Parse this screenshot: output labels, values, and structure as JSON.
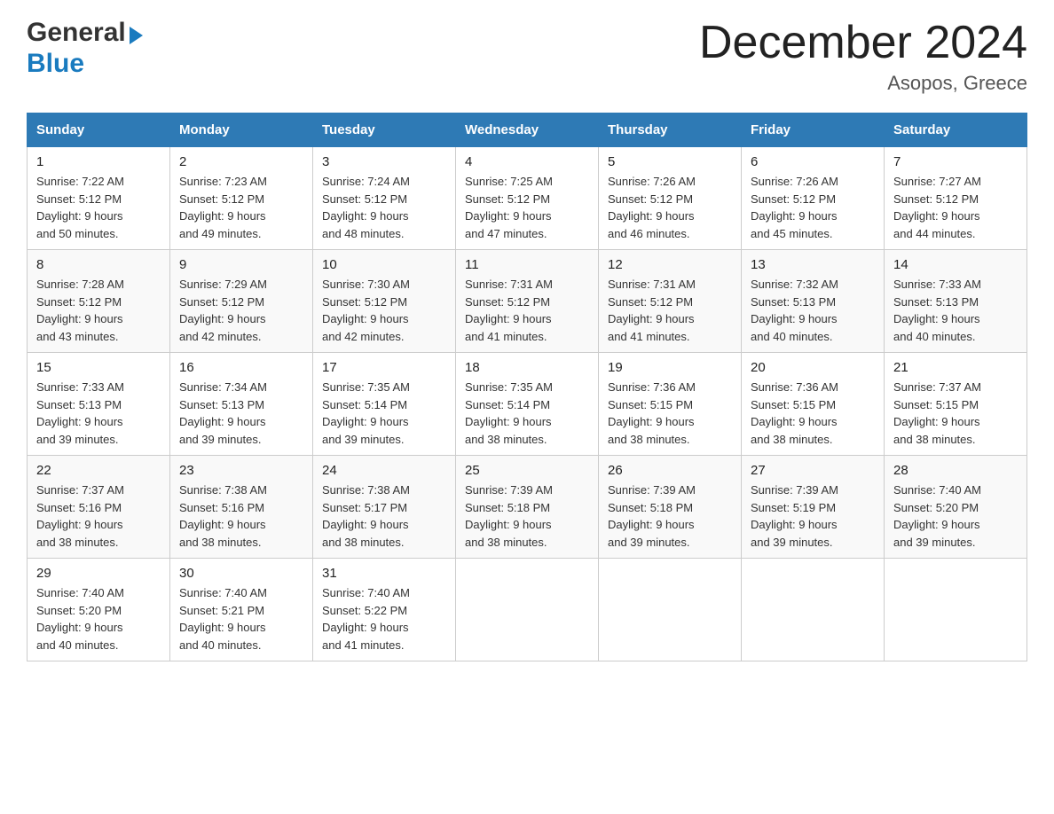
{
  "logo": {
    "general": "General",
    "blue": "Blue",
    "arrow": "▶"
  },
  "title": "December 2024",
  "subtitle": "Asopos, Greece",
  "days_of_week": [
    "Sunday",
    "Monday",
    "Tuesday",
    "Wednesday",
    "Thursday",
    "Friday",
    "Saturday"
  ],
  "weeks": [
    [
      {
        "day": "1",
        "sunrise": "7:22 AM",
        "sunset": "5:12 PM",
        "daylight": "9 hours and 50 minutes."
      },
      {
        "day": "2",
        "sunrise": "7:23 AM",
        "sunset": "5:12 PM",
        "daylight": "9 hours and 49 minutes."
      },
      {
        "day": "3",
        "sunrise": "7:24 AM",
        "sunset": "5:12 PM",
        "daylight": "9 hours and 48 minutes."
      },
      {
        "day": "4",
        "sunrise": "7:25 AM",
        "sunset": "5:12 PM",
        "daylight": "9 hours and 47 minutes."
      },
      {
        "day": "5",
        "sunrise": "7:26 AM",
        "sunset": "5:12 PM",
        "daylight": "9 hours and 46 minutes."
      },
      {
        "day": "6",
        "sunrise": "7:26 AM",
        "sunset": "5:12 PM",
        "daylight": "9 hours and 45 minutes."
      },
      {
        "day": "7",
        "sunrise": "7:27 AM",
        "sunset": "5:12 PM",
        "daylight": "9 hours and 44 minutes."
      }
    ],
    [
      {
        "day": "8",
        "sunrise": "7:28 AM",
        "sunset": "5:12 PM",
        "daylight": "9 hours and 43 minutes."
      },
      {
        "day": "9",
        "sunrise": "7:29 AM",
        "sunset": "5:12 PM",
        "daylight": "9 hours and 42 minutes."
      },
      {
        "day": "10",
        "sunrise": "7:30 AM",
        "sunset": "5:12 PM",
        "daylight": "9 hours and 42 minutes."
      },
      {
        "day": "11",
        "sunrise": "7:31 AM",
        "sunset": "5:12 PM",
        "daylight": "9 hours and 41 minutes."
      },
      {
        "day": "12",
        "sunrise": "7:31 AM",
        "sunset": "5:12 PM",
        "daylight": "9 hours and 41 minutes."
      },
      {
        "day": "13",
        "sunrise": "7:32 AM",
        "sunset": "5:13 PM",
        "daylight": "9 hours and 40 minutes."
      },
      {
        "day": "14",
        "sunrise": "7:33 AM",
        "sunset": "5:13 PM",
        "daylight": "9 hours and 40 minutes."
      }
    ],
    [
      {
        "day": "15",
        "sunrise": "7:33 AM",
        "sunset": "5:13 PM",
        "daylight": "9 hours and 39 minutes."
      },
      {
        "day": "16",
        "sunrise": "7:34 AM",
        "sunset": "5:13 PM",
        "daylight": "9 hours and 39 minutes."
      },
      {
        "day": "17",
        "sunrise": "7:35 AM",
        "sunset": "5:14 PM",
        "daylight": "9 hours and 39 minutes."
      },
      {
        "day": "18",
        "sunrise": "7:35 AM",
        "sunset": "5:14 PM",
        "daylight": "9 hours and 38 minutes."
      },
      {
        "day": "19",
        "sunrise": "7:36 AM",
        "sunset": "5:15 PM",
        "daylight": "9 hours and 38 minutes."
      },
      {
        "day": "20",
        "sunrise": "7:36 AM",
        "sunset": "5:15 PM",
        "daylight": "9 hours and 38 minutes."
      },
      {
        "day": "21",
        "sunrise": "7:37 AM",
        "sunset": "5:15 PM",
        "daylight": "9 hours and 38 minutes."
      }
    ],
    [
      {
        "day": "22",
        "sunrise": "7:37 AM",
        "sunset": "5:16 PM",
        "daylight": "9 hours and 38 minutes."
      },
      {
        "day": "23",
        "sunrise": "7:38 AM",
        "sunset": "5:16 PM",
        "daylight": "9 hours and 38 minutes."
      },
      {
        "day": "24",
        "sunrise": "7:38 AM",
        "sunset": "5:17 PM",
        "daylight": "9 hours and 38 minutes."
      },
      {
        "day": "25",
        "sunrise": "7:39 AM",
        "sunset": "5:18 PM",
        "daylight": "9 hours and 38 minutes."
      },
      {
        "day": "26",
        "sunrise": "7:39 AM",
        "sunset": "5:18 PM",
        "daylight": "9 hours and 39 minutes."
      },
      {
        "day": "27",
        "sunrise": "7:39 AM",
        "sunset": "5:19 PM",
        "daylight": "9 hours and 39 minutes."
      },
      {
        "day": "28",
        "sunrise": "7:40 AM",
        "sunset": "5:20 PM",
        "daylight": "9 hours and 39 minutes."
      }
    ],
    [
      {
        "day": "29",
        "sunrise": "7:40 AM",
        "sunset": "5:20 PM",
        "daylight": "9 hours and 40 minutes."
      },
      {
        "day": "30",
        "sunrise": "7:40 AM",
        "sunset": "5:21 PM",
        "daylight": "9 hours and 40 minutes."
      },
      {
        "day": "31",
        "sunrise": "7:40 AM",
        "sunset": "5:22 PM",
        "daylight": "9 hours and 41 minutes."
      },
      null,
      null,
      null,
      null
    ]
  ],
  "labels": {
    "sunrise": "Sunrise:",
    "sunset": "Sunset:",
    "daylight": "Daylight:"
  }
}
